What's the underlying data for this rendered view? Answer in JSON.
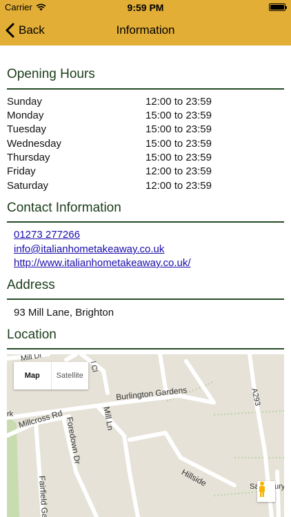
{
  "status_bar": {
    "carrier": "Carrier",
    "time": "9:59 PM"
  },
  "nav": {
    "back_label": "Back",
    "title": "Information"
  },
  "opening_hours": {
    "title": "Opening Hours",
    "rows": [
      {
        "day": "Sunday",
        "time": "12:00 to 23:59"
      },
      {
        "day": "Monday",
        "time": "15:00 to 23:59"
      },
      {
        "day": "Tuesday",
        "time": "15:00 to 23:59"
      },
      {
        "day": "Wednesday",
        "time": "15:00 to 23:59"
      },
      {
        "day": "Thursday",
        "time": "15:00 to 23:59"
      },
      {
        "day": "Friday",
        "time": "12:00 to 23:59"
      },
      {
        "day": "Saturday",
        "time": "12:00 to 23:59"
      }
    ]
  },
  "contact": {
    "title": "Contact Information",
    "phone": "01273 277266",
    "email": "info@italianhometakeaway.co.uk",
    "website": "http://www.italianhometakeaway.co.uk/"
  },
  "address": {
    "title": "Address",
    "text": "93 Mill Lane, Brighton"
  },
  "location": {
    "title": "Location",
    "map_type_options": [
      "Map",
      "Satellite"
    ],
    "street_labels": {
      "burlington": "Burlington Gardens",
      "millcross": "Millcross Rd",
      "foredown": "Foredown Dr",
      "mill_ln": "Mill Ln",
      "hillside": "Hillside",
      "a293": "A293",
      "fairfield": "Fairfield Ga",
      "mill_dr": "Mill Dr",
      "cl": "l Cl",
      "rk": "rk",
      "sa": "Sa",
      "ury": "ury"
    }
  },
  "colors": {
    "accent": "#e2ae36",
    "heading": "#1a3d1a",
    "rule": "#254a25",
    "link": "#1a0dab",
    "map_bg": "#e6e2d8"
  },
  "icons": {
    "back": "chevron-left-icon",
    "wifi": "wifi-icon",
    "battery": "battery-icon",
    "pegman": "pegman-icon"
  }
}
